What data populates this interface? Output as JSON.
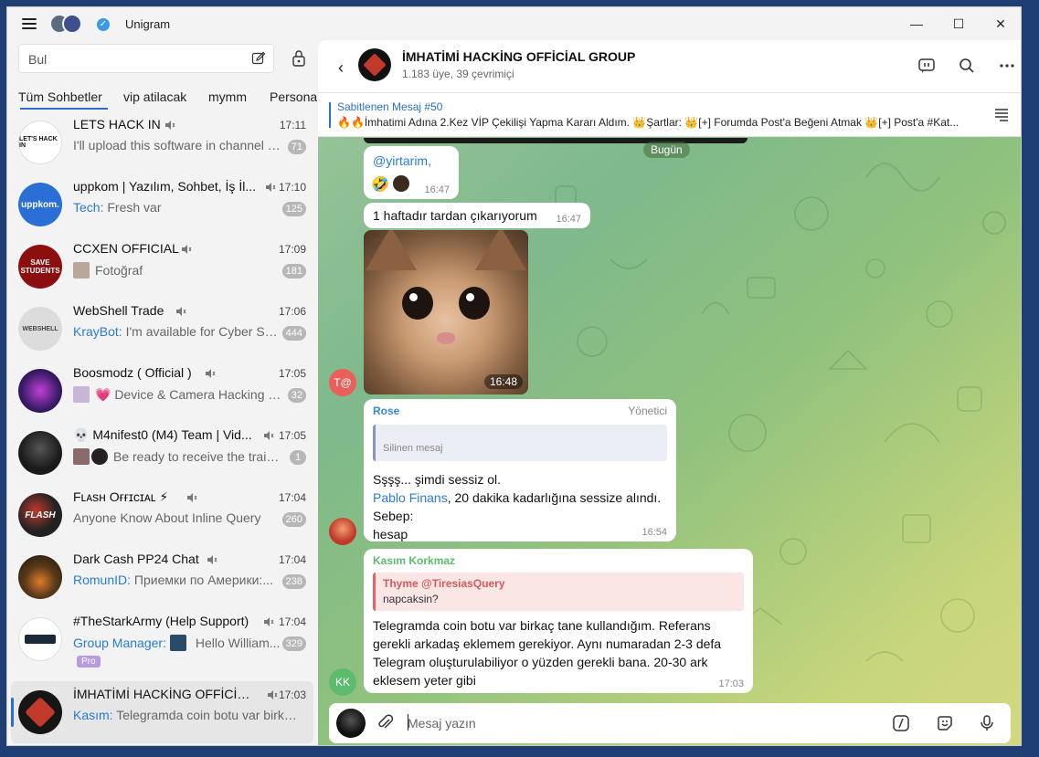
{
  "app": {
    "title": "Unigram"
  },
  "window_controls": {
    "minimize": "—",
    "maximize": "☐",
    "close": "✕"
  },
  "search": {
    "placeholder": "Bul"
  },
  "tabs": [
    "Tüm Sohbetler",
    "vip atilacak",
    "mymm",
    "Personal"
  ],
  "chats": [
    {
      "name": "LETS HACK IN",
      "time": "17:11",
      "sender": "",
      "preview": "I'll upload this software in channel a...",
      "badge": "71",
      "avatar_color": "#ffffff",
      "avatar_text": "LET'S HACK IN"
    },
    {
      "name": "uppkom | Yazılım, Sohbet, İş İl...",
      "time": "17:10",
      "sender": "Tech:",
      "preview": " Fresh var",
      "badge": "125",
      "avatar_color": "#2a6fd6",
      "avatar_text": "uppkom."
    },
    {
      "name": "CCXEN OFFICIAL",
      "time": "17:09",
      "sender": "",
      "preview": "Fotoğraf",
      "badge": "181",
      "avatar_color": "#8c0f0f",
      "avatar_text": "SAVE STUDENTS"
    },
    {
      "name": "WebShell Trade",
      "time": "17:06",
      "sender": "KrayBot:",
      "preview": " I'm available for Cyber Se...",
      "badge": "444",
      "avatar_color": "#d8d8d8",
      "avatar_text": "WEBSHELL"
    },
    {
      "name": "Boosmodz ( Official )",
      "time": "17:05",
      "sender": "",
      "preview": "💗 Device & Camera Hacking B...",
      "badge": "32",
      "avatar_color": "#3a1c6a",
      "avatar_text": ""
    },
    {
      "name": "💀 M4nifest0 (M4) Team | Vid...",
      "time": "17:05",
      "sender": "",
      "preview": "Be ready to receive the traini...",
      "badge": "1",
      "avatar_color": "#1a1a1a",
      "avatar_text": ""
    },
    {
      "name": "Fʟᴀsʜ Oғғɪᴄɪᴀʟ ⚡",
      "time": "17:04",
      "sender": "",
      "preview": "Anyone Know About Inline Query",
      "badge": "260",
      "avatar_color": "#222222",
      "avatar_text": "FLASH"
    },
    {
      "name": "Dark Cash PP24 Chat",
      "time": "17:04",
      "sender": "RomunID:",
      "preview": " Приемки по Америки:...",
      "badge": "238",
      "avatar_color": "#5a3a1a",
      "avatar_text": ""
    },
    {
      "name": "#TheStarkArmy (Help Support)",
      "time": "17:04",
      "sender": "Group Manager:",
      "preview": " Hello William...",
      "badge": "329",
      "avatar_color": "#ffffff",
      "avatar_text": ""
    },
    {
      "name": "İMHATİMİ HACKİNG OFFİCİAL...",
      "time": "17:03",
      "sender": "Kasım:",
      "preview": " Telegramda coin botu var birkaç...",
      "badge": "",
      "avatar_color": "#151515",
      "avatar_text": ""
    }
  ],
  "pro_label": "Pro",
  "group": {
    "title": "İMHATİMİ HACKİNG OFFİCİAL GROUP",
    "subtitle": "1.183 üye, 39 çevrimiçi"
  },
  "pinned": {
    "title": "Sabitlenen Mesaj #50",
    "text": "🔥🔥İmhatimi Adına 2.Kez VİP Çekilişi Yapma Kararı Aldım. 👑Şartlar: 👑[+] Forumda Post'a Beğeni Atmak 👑[+] Post'a #Kat..."
  },
  "date_pill": "Bugün",
  "messages": [
    {
      "text": "@yirtarim,",
      "time": "16:47",
      "reaction": "🤣"
    },
    {
      "text": "1 haftadır tardan çıkarıyorum",
      "time": "16:47"
    },
    {
      "image_time": "16:48",
      "sender_initials": "T@"
    },
    {
      "sender": "Rose",
      "role": "Yönetici",
      "reply_text": "Silinen mesaj",
      "line1": "Sşşş... şimdi sessiz ol.",
      "mention": "Pablo Finans",
      "line2": ", 20 dakika kadarlığına sessize alındı.",
      "line3": "Sebep:",
      "line4": "hesap",
      "time": "16:54"
    },
    {
      "sender": "Kasım Korkmaz",
      "reply_sender": "Thyme @TiresiasQuery",
      "reply_text": "napcaksin?",
      "text": "Telegramda coin botu var birkaç tane kullandığım. Referans gerekli arkadaş eklemem gerekiyor. Aynı numaradan 2-3 defa Telegram oluşturulabiliyor o yüzden gerekli bana. 20-30 ark eklesem yeter gibi",
      "time": "17:03",
      "sender_initials": "KK"
    }
  ],
  "composer": {
    "placeholder": "Mesaj yazın"
  },
  "colors": {
    "accent": "#2a6fcf",
    "kk_green": "#5dbb6e",
    "rose_name": "#3a86d6"
  }
}
